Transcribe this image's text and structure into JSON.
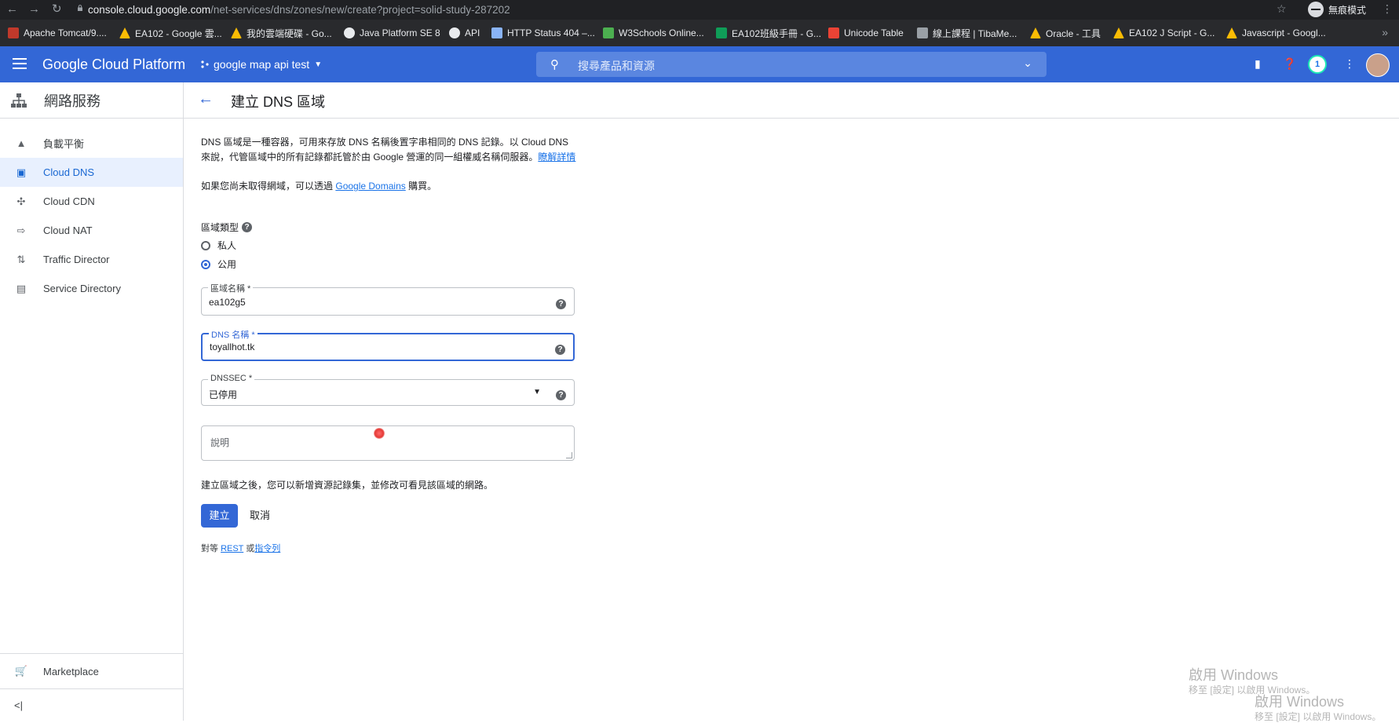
{
  "browser": {
    "url_host": "console.cloud.google.com",
    "url_path": "/net-services/dns/zones/new/create?project=solid-study-287202",
    "profile_label": "無痕模式"
  },
  "bookmarks": [
    {
      "label": "Apache Tomcat/9....",
      "color": "#c0392b"
    },
    {
      "label": "EA102 - Google 雲...",
      "color": "#fbbc04"
    },
    {
      "label": "我的雲端硬碟 - Go...",
      "color": "#fbbc04"
    },
    {
      "label": "Java Platform SE 8",
      "color": "#e8eaed"
    },
    {
      "label": "API",
      "color": "#e8eaed"
    },
    {
      "label": "HTTP Status 404 –...",
      "color": "#8ab4f8"
    },
    {
      "label": "W3Schools Online...",
      "color": "#4caf50"
    },
    {
      "label": "EA102班級手冊 - G...",
      "color": "#0f9d58"
    },
    {
      "label": "Unicode Table",
      "color": "#ea4335"
    },
    {
      "label": "線上課程 | TibaMe...",
      "color": "#9aa0a6"
    },
    {
      "label": "Oracle - 工具",
      "color": "#fbbc04"
    },
    {
      "label": "EA102 J Script - G...",
      "color": "#fbbc04"
    },
    {
      "label": "Javascript - Googl...",
      "color": "#fbbc04"
    }
  ],
  "header": {
    "title": "Google Cloud Platform",
    "project": "google map api test",
    "search_placeholder": "搜尋產品和資源",
    "notifications": "1"
  },
  "sidebar": {
    "title": "網路服務",
    "items": [
      {
        "label": "負載平衡",
        "icon": "load-balancing-icon"
      },
      {
        "label": "Cloud DNS",
        "icon": "dns-icon"
      },
      {
        "label": "Cloud CDN",
        "icon": "cdn-icon"
      },
      {
        "label": "Cloud NAT",
        "icon": "nat-icon"
      },
      {
        "label": "Traffic Director",
        "icon": "traffic-director-icon"
      },
      {
        "label": "Service Directory",
        "icon": "service-directory-icon"
      }
    ],
    "active_index": 1,
    "marketplace": "Marketplace",
    "collapse": "<|"
  },
  "page": {
    "title": "建立 DNS 區域",
    "intro": "DNS 區域是一種容器，可用來存放 DNS 名稱後置字串相同的 DNS 記錄。以 Cloud DNS 來說，代管區域中的所有記錄都託管於由 Google 營運的同一組權威名稱伺服器。",
    "intro_link": "瞭解詳情",
    "domains_prefix": "如果您尚未取得網域，可以透過",
    "domains_link": "Google Domains",
    "domains_suffix": "購買。",
    "zone_type_label": "區域類型",
    "radio_private": "私人",
    "radio_public": "公用",
    "zone_name_label": "區域名稱 *",
    "zone_name_value": "ea102g5",
    "dns_name_label": "DNS 名稱 *",
    "dns_name_value": "toyallhot.tk",
    "dnssec_label": "DNSSEC *",
    "dnssec_value": "已停用",
    "description_placeholder": "說明",
    "after_note": "建立區域之後，您可以新增資源記錄集，並修改可看見該區域的網路。",
    "create_button": "建立",
    "cancel_button": "取消",
    "equiv_prefix": "對等",
    "equiv_rest": "REST",
    "equiv_or": "或",
    "equiv_cli": "指令列"
  },
  "watermark": {
    "line1": "啟用 Windows",
    "line2": "移至 [設定] 以啟用 Windows。"
  },
  "colors": {
    "brand_blue": "#3367d6",
    "active_nav_bg": "#e8f0fe",
    "link": "#1a73e8"
  }
}
